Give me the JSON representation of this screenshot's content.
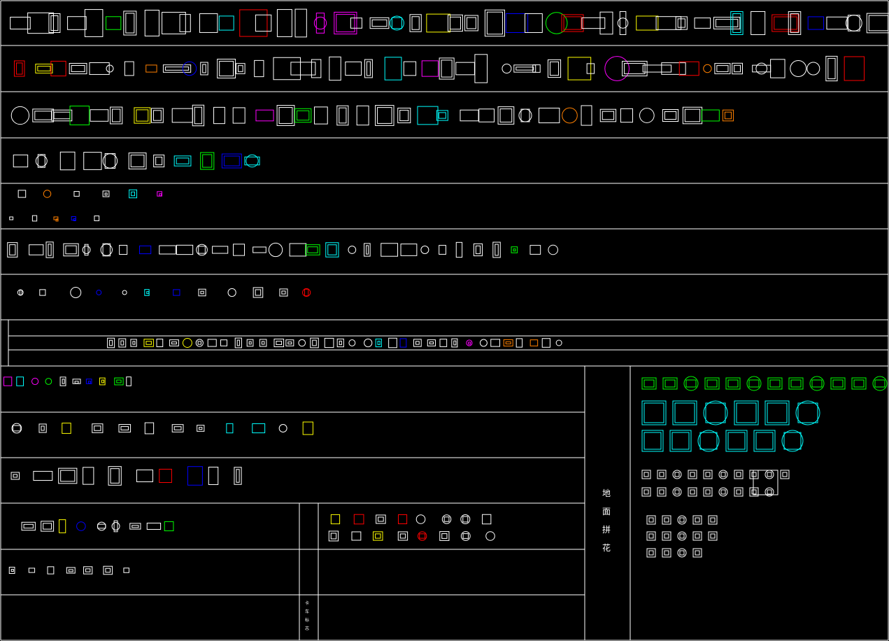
{
  "drawing": {
    "background": "#000000",
    "line_color": "#ffffff",
    "palette": [
      "#ffffff",
      "#00ffff",
      "#ff00ff",
      "#ffff00",
      "#00ff00",
      "#0000ff",
      "#ff0000",
      "#ff8000"
    ]
  },
  "section_label": [
    "地",
    "面",
    "拼",
    "花"
  ],
  "small_label": [
    "卡",
    "车",
    "标",
    "志"
  ]
}
